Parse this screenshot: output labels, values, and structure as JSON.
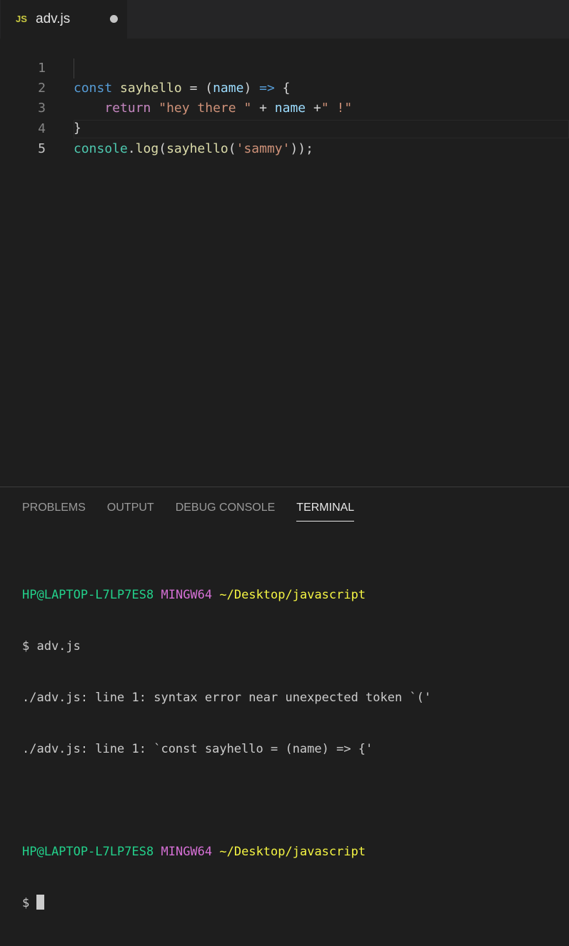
{
  "tab": {
    "badge": "JS",
    "label": "adv.js"
  },
  "editor": {
    "line_numbers": [
      "1",
      "2",
      "3",
      "4",
      "5"
    ],
    "lines": [
      [
        "const",
        " ",
        "sayhello",
        " = (",
        "name",
        ") ",
        "=>",
        " {"
      ],
      [
        "    ",
        "return",
        " ",
        "\"hey there \"",
        " + ",
        "name",
        " +",
        "\" !\""
      ],
      [
        "}"
      ],
      [
        "console",
        ".",
        "log",
        "(",
        "sayhello",
        "(",
        "'sammy'",
        "));"
      ]
    ]
  },
  "panel": {
    "tabs": [
      "PROBLEMS",
      "OUTPUT",
      "DEBUG CONSOLE",
      "TERMINAL"
    ],
    "terminal": {
      "prompt1": {
        "user": "HP@LAPTOP-L7LP7ES8",
        "env": "MINGW64",
        "path": "~/Desktop/javascript"
      },
      "cmd1": "$ adv.js",
      "out1": "./adv.js: line 1: syntax error near unexpected token `('",
      "out2": "./adv.js: line 1: `const sayhello = (name) => {'",
      "prompt2": {
        "user": "HP@LAPTOP-L7LP7ES8",
        "env": "MINGW64",
        "path": "~/Desktop/javascript"
      },
      "cmd2": "$ "
    }
  },
  "colors": {
    "keyword": "#569cd6",
    "function": "#dcdcaa",
    "variable": "#9cdcfe",
    "control": "#c586c0",
    "string": "#ce9178",
    "class": "#4ec9b0",
    "term_user": "#23d18b",
    "term_env": "#d670d6",
    "term_path": "#f5f543"
  },
  "icons": {
    "tab_modified": "dirty-dot-icon",
    "terminal_cursor": "cursor-block-icon"
  }
}
